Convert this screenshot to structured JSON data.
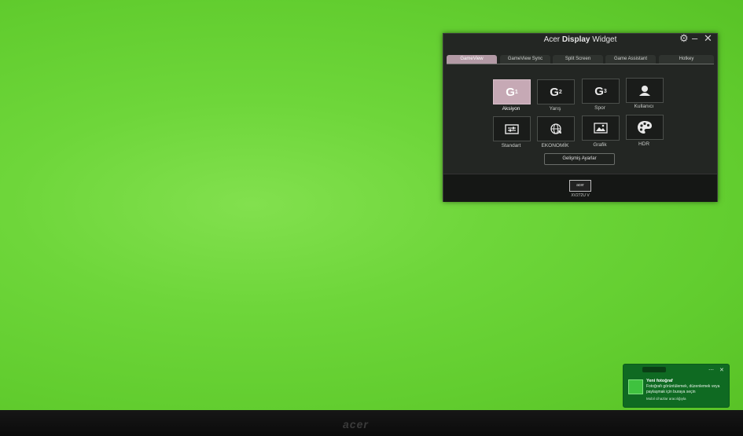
{
  "widget": {
    "title_prefix": "Acer ",
    "title_bold": "Display",
    "title_suffix": " Widget",
    "tabs": [
      {
        "label": "GameView"
      },
      {
        "label": "GameView Sync"
      },
      {
        "label": "Split Screen"
      },
      {
        "label": "Game Assistant"
      },
      {
        "label": "Hotkey"
      }
    ],
    "active_tab": "GameView",
    "modes": [
      {
        "label": "Aksiyon",
        "icon": "G1",
        "icon_name": "g1-icon",
        "active": true
      },
      {
        "label": "Yarış",
        "icon": "G2",
        "icon_name": "g2-icon",
        "active": false
      },
      {
        "label": "Spor",
        "icon": "G3",
        "icon_name": "g3-icon",
        "active": false
      },
      {
        "label": "Kullanıcı",
        "icon": "user",
        "icon_name": "user-icon",
        "active": false
      },
      {
        "label": "Standart",
        "icon": "sliders",
        "icon_name": "sliders-icon",
        "active": false
      },
      {
        "label": "EKONOMİK",
        "icon": "globe-leaf",
        "icon_name": "eco-globe-icon",
        "active": false
      },
      {
        "label": "Grafik",
        "icon": "image",
        "icon_name": "graphics-icon",
        "active": false
      },
      {
        "label": "HDR",
        "icon": "palette",
        "icon_name": "palette-icon",
        "active": false
      }
    ],
    "advanced_button": "Gelişmiş Ayarlar",
    "monitor_logo": "acer",
    "monitor_name": "XV272U V"
  },
  "toast": {
    "title": "Yeni fotoğraf",
    "body": "Fotoğrafı görüntülemek, düzenlemek veya paylaşmak için buraya seçin",
    "footer": "Mobil cihazlar aracılığıyla"
  },
  "bezel": {
    "logo": "acer"
  },
  "colors": {
    "screen": "#6ed63a",
    "widget_bg": "#232623",
    "active_tile": "#c6a9b5",
    "toast_bg": "#0f6a22"
  }
}
